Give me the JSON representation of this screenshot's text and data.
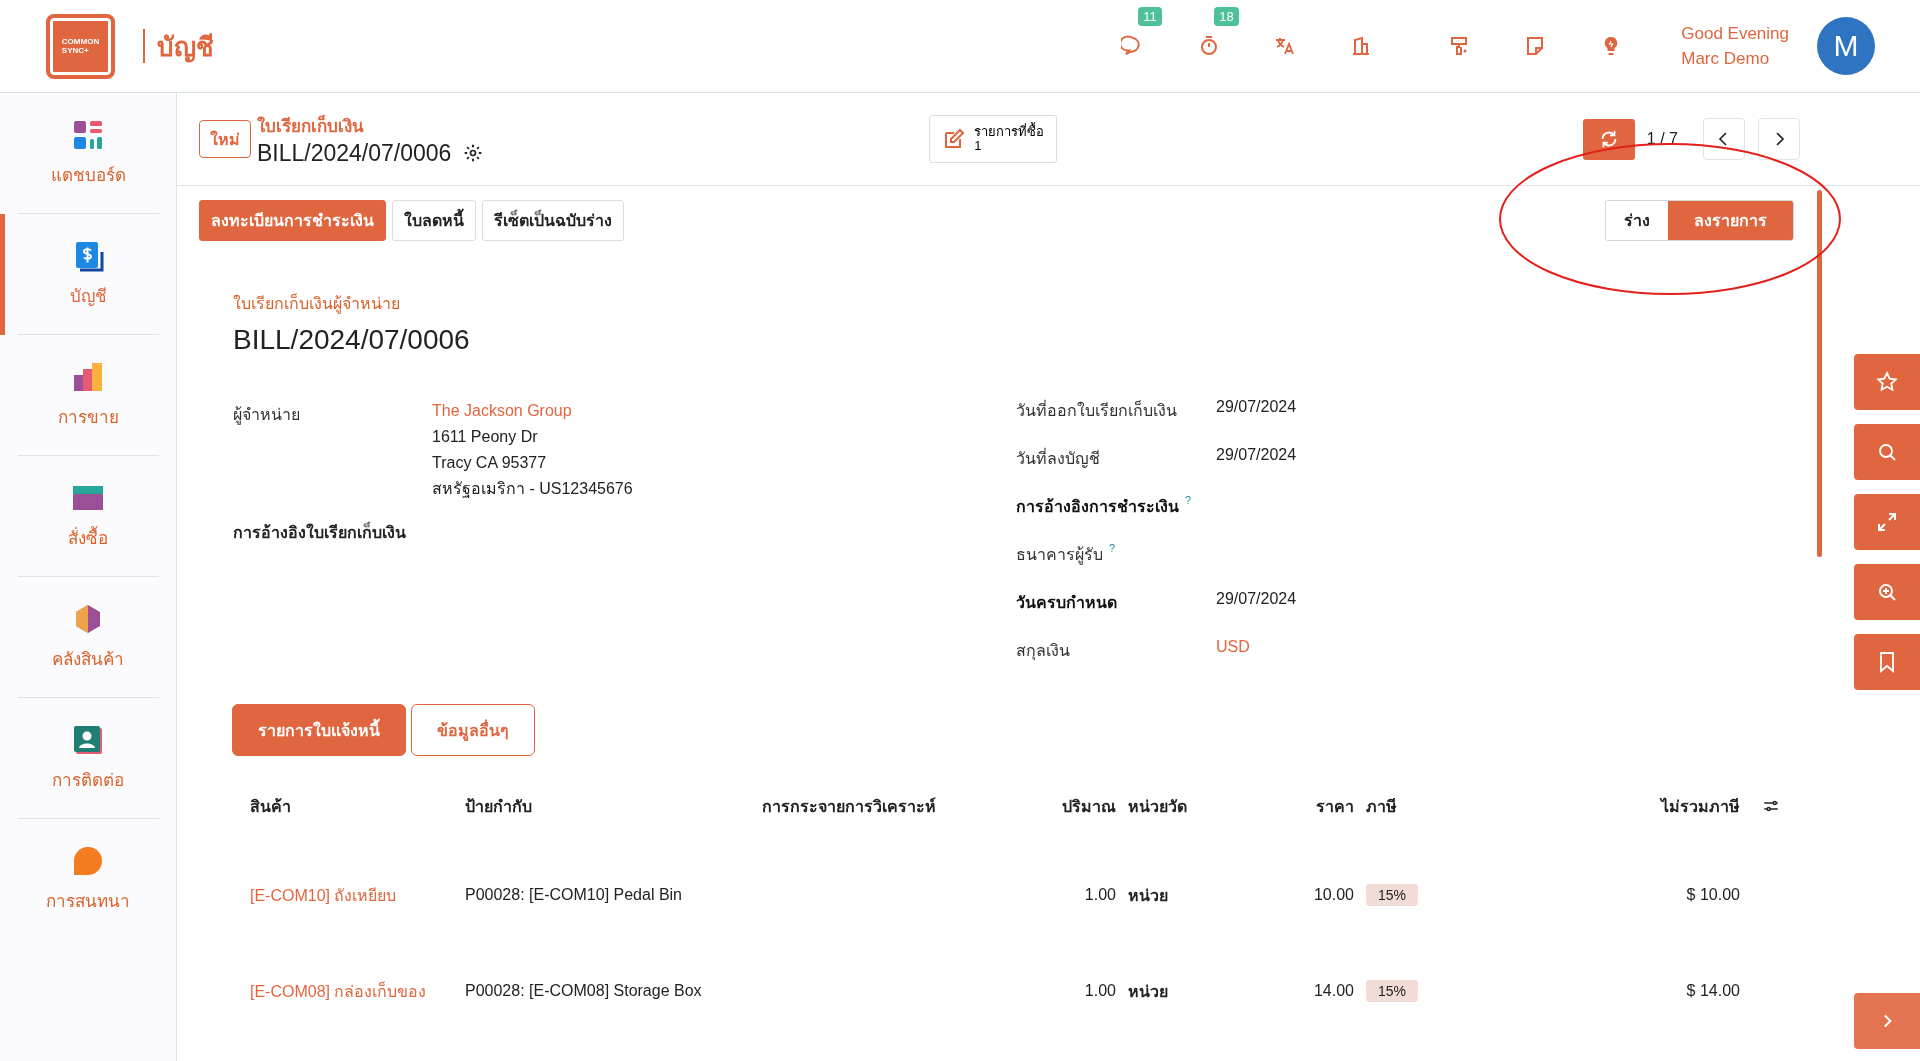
{
  "app": {
    "logo_lines": [
      "COMMON",
      "SYNC+"
    ],
    "module": "บัญชี"
  },
  "topbar": {
    "icons": [
      {
        "kind": "chat",
        "badge": "11"
      },
      {
        "kind": "timer",
        "badge": "18"
      },
      {
        "kind": "translate"
      },
      {
        "kind": "building"
      },
      {
        "kind": "paint"
      },
      {
        "kind": "note"
      },
      {
        "kind": "bulb"
      }
    ],
    "greeting": "Good Evening",
    "user": "Marc Demo",
    "avatar": "M"
  },
  "sidebar": {
    "items": [
      {
        "kind": "dashboard",
        "label": "แดชบอร์ด",
        "selected": false
      },
      {
        "kind": "accounting",
        "label": "บัญชี",
        "selected": true
      },
      {
        "kind": "sales",
        "label": "การขาย",
        "selected": false
      },
      {
        "kind": "purchase",
        "label": "สั่งซื้อ",
        "selected": false
      },
      {
        "kind": "inventory",
        "label": "คลังสินค้า",
        "selected": false
      },
      {
        "kind": "contacts",
        "label": "การติดต่อ",
        "selected": false
      },
      {
        "kind": "chat",
        "label": "การสนทนา",
        "selected": false
      }
    ]
  },
  "control": {
    "new_button": "ใหม่",
    "breadcrumb": "ใบเรียกเก็บเงิน",
    "record": "BILL/2024/07/0006",
    "smart_button": {
      "label": "รายการที่ซื้อ",
      "count": "1"
    },
    "pager": "1 / 7",
    "actions": [
      {
        "label": "ลงทะเบียนการชำระเงิน",
        "primary": true
      },
      {
        "label": "ใบลดหนี้",
        "primary": false
      },
      {
        "label": "รีเซ็ตเป็นฉบับร่าง",
        "primary": false
      }
    ],
    "status": [
      {
        "label": "ร่าง",
        "selected": false
      },
      {
        "label": "ลงรายการ",
        "selected": true
      }
    ]
  },
  "form": {
    "subtitle": "ใบเรียกเก็บเงินผู้จำหน่าย",
    "title": "BILL/2024/07/0006",
    "vendor": {
      "label": "ผู้จำหน่าย",
      "name": "The Jackson Group",
      "address": [
        "1611 Peony Dr",
        "Tracy CA 95377",
        "สหรัฐอเมริกา - US12345676"
      ]
    },
    "reference_label": "การอ้างอิงใบเรียกเก็บเงิน",
    "right_fields": [
      {
        "label": "วันที่ออกใบเรียกเก็บเงิน",
        "value": "29/07/2024",
        "required": false,
        "link": false
      },
      {
        "label": "วันที่ลงบัญชี",
        "value": "29/07/2024",
        "required": false,
        "link": false
      },
      {
        "label": "การอ้างอิงการชำระเงิน",
        "hint": "?",
        "required": true
      },
      {
        "label": "ธนาคารผู้รับ",
        "hint": "?",
        "required": false
      },
      {
        "label": "วันครบกำหนด",
        "value": "29/07/2024",
        "required": true,
        "link": false
      },
      {
        "label": "สกุลเงิน",
        "value": "USD",
        "required": false,
        "link": true
      }
    ]
  },
  "tabs": [
    {
      "label": "รายการใบแจ้งหนี้",
      "selected": true
    },
    {
      "label": "ข้อมูลอื่นๆ",
      "selected": false
    }
  ],
  "table": {
    "columns": [
      "สินค้า",
      "ป้ายกำกับ",
      "การกระจายการวิเคราะห์",
      "ปริมาณ",
      "หน่วยวัด",
      "ราคา",
      "ภาษี",
      "ไม่รวมภาษี"
    ],
    "rows": [
      {
        "product": "[E-COM10] ถังเหยียบ",
        "label": "P00028: [E-COM10] Pedal Bin",
        "quantity": "1.00",
        "uom": "หน่วย",
        "price": "10.00",
        "tax": "15%",
        "subtotal": "$ 10.00"
      },
      {
        "product": "[E-COM08] กล่องเก็บของ",
        "label": "P00028: [E-COM08] Storage Box",
        "quantity": "1.00",
        "uom": "หน่วย",
        "price": "14.00",
        "tax": "15%",
        "subtotal": "$ 14.00"
      }
    ]
  },
  "side_tools": [
    {
      "kind": "star"
    },
    {
      "kind": "search"
    },
    {
      "kind": "expand"
    },
    {
      "kind": "zoom-in"
    },
    {
      "kind": "bookmark"
    }
  ]
}
